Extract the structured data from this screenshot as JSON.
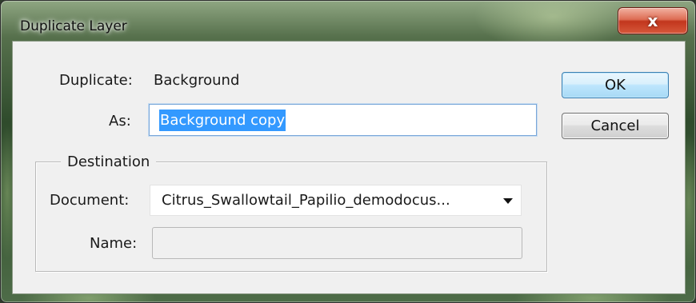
{
  "window": {
    "title": "Duplicate Layer",
    "close_label": "x"
  },
  "dialog": {
    "duplicate_label": "Duplicate:",
    "duplicate_value": "Background",
    "as_label": "As:",
    "as_value": "Background copy",
    "destination_title": "Destination",
    "document_label": "Document:",
    "document_value": "Citrus_Swallowtail_Papilio_demodocus...",
    "name_label": "Name:",
    "name_value": ""
  },
  "buttons": {
    "ok": "OK",
    "cancel": "Cancel"
  },
  "colors": {
    "selection": "#3399ff",
    "close_button": "#c2361d",
    "default_button_border": "#3c7fb1"
  }
}
